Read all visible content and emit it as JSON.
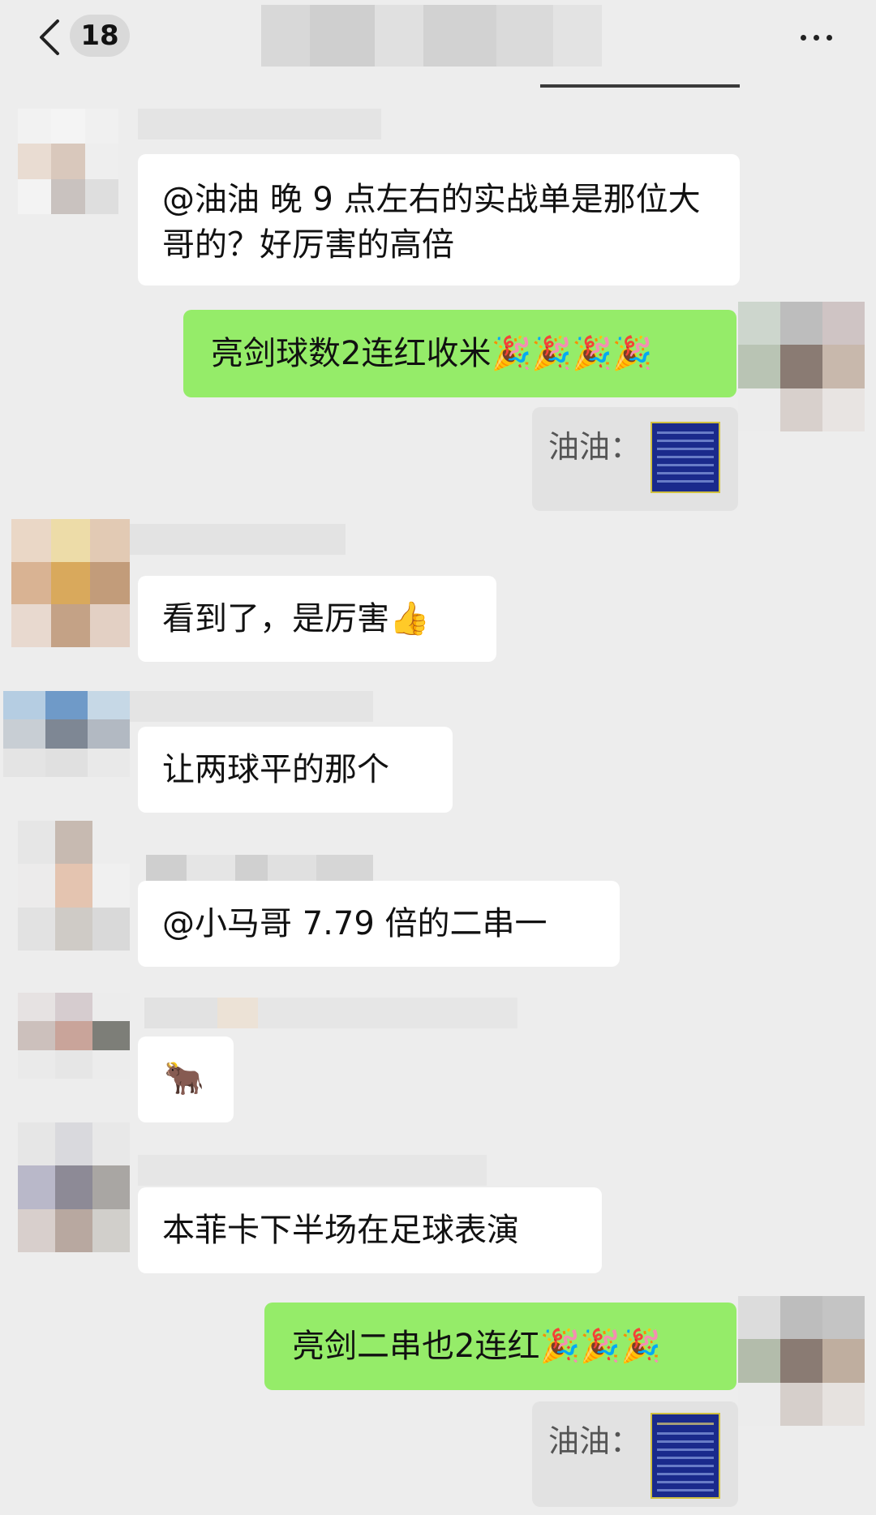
{
  "header": {
    "back_icon": "chevron-left-icon",
    "unread_count": "18",
    "more_icon": "more-dots-icon"
  },
  "colors": {
    "background": "#ededed",
    "incoming_bubble": "#ffffff",
    "outgoing_bubble": "#95ec69",
    "quote_background": "#e2e2e2"
  },
  "messages": [
    {
      "id": "m1",
      "direction": "incoming",
      "text": "@油油  晚 9 点左右的实战单是那位大哥的？好厉害的高倍"
    },
    {
      "id": "m2",
      "direction": "outgoing",
      "text": "亮剑球数2连红收米🎉🎉🎉🎉",
      "quote": {
        "label": "油油："
      }
    },
    {
      "id": "m3",
      "direction": "incoming",
      "text": "看到了，是厉害👍"
    },
    {
      "id": "m4",
      "direction": "incoming",
      "text": "让两球平的那个"
    },
    {
      "id": "m5",
      "direction": "incoming",
      "text": "@小马哥  7.79 倍的二串一"
    },
    {
      "id": "m6",
      "direction": "incoming",
      "text": "🐂",
      "icon": "ox-emoji"
    },
    {
      "id": "m7",
      "direction": "incoming",
      "text": "本菲卡下半场在足球表演"
    },
    {
      "id": "m8",
      "direction": "outgoing",
      "text": "亮剑二串也2连红🎉🎉🎉",
      "quote": {
        "label": "油油："
      }
    }
  ]
}
